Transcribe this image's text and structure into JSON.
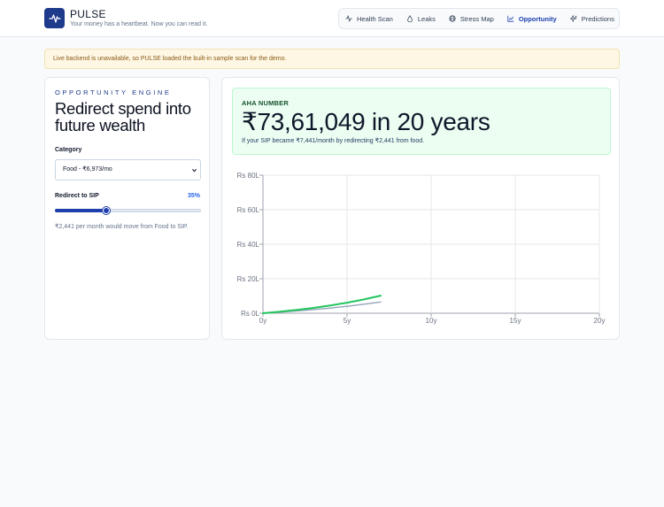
{
  "brand": {
    "title": "PULSE",
    "subtitle": "Your money has a heartbeat. Now you can read it.",
    "logo_icon": "pulse-line-icon"
  },
  "nav": {
    "items": [
      {
        "label": "Health Scan",
        "icon": "activity-icon",
        "active": false
      },
      {
        "label": "Leaks",
        "icon": "droplet-icon",
        "active": false
      },
      {
        "label": "Stress Map",
        "icon": "globe-icon",
        "active": false
      },
      {
        "label": "Opportunity",
        "icon": "line-chart-icon",
        "active": true
      },
      {
        "label": "Predictions",
        "icon": "sparkles-icon",
        "active": false
      }
    ]
  },
  "alert": {
    "text": "Live backend is unavailable, so PULSE loaded the built-in sample scan for the demo."
  },
  "engine": {
    "eyebrow": "OPPORTUNITY ENGINE",
    "title": "Redirect spend into future wealth",
    "category_label": "Category",
    "category_value": "Food - ₹6,973/mo",
    "redirect_label": "Redirect to SIP",
    "redirect_percent": "35%",
    "redirect_fraction": 0.35,
    "note": "₹2,441 per month would move from Food to SIP."
  },
  "aha": {
    "label": "AHA NUMBER",
    "number": "₹73,61,049 in 20 years",
    "description": "If your SIP became ₹7,441/month by redirecting ₹2,441 from food."
  },
  "chart_data": {
    "type": "line",
    "x_ticks": [
      "0y",
      "5y",
      "10y",
      "15y",
      "20y"
    ],
    "y_ticks": [
      "Rs 0L",
      "Rs 20L",
      "Rs 40L",
      "Rs 60L",
      "Rs 80L"
    ],
    "xlim": [
      0,
      20
    ],
    "ylim": [
      0,
      80
    ],
    "grid": true,
    "series": [
      {
        "color": "#22c55e",
        "x": [
          0,
          1,
          2,
          3,
          4,
          5,
          6,
          7
        ],
        "y": [
          0,
          0.9,
          1.9,
          3.1,
          4.5,
          6.1,
          8.0,
          10.2
        ]
      },
      {
        "color": "#94a3b8",
        "x": [
          0,
          1,
          2,
          3,
          4,
          5,
          6,
          7
        ],
        "y": [
          0,
          0.6,
          1.3,
          2.1,
          3.0,
          4.0,
          5.2,
          6.5
        ]
      }
    ]
  }
}
